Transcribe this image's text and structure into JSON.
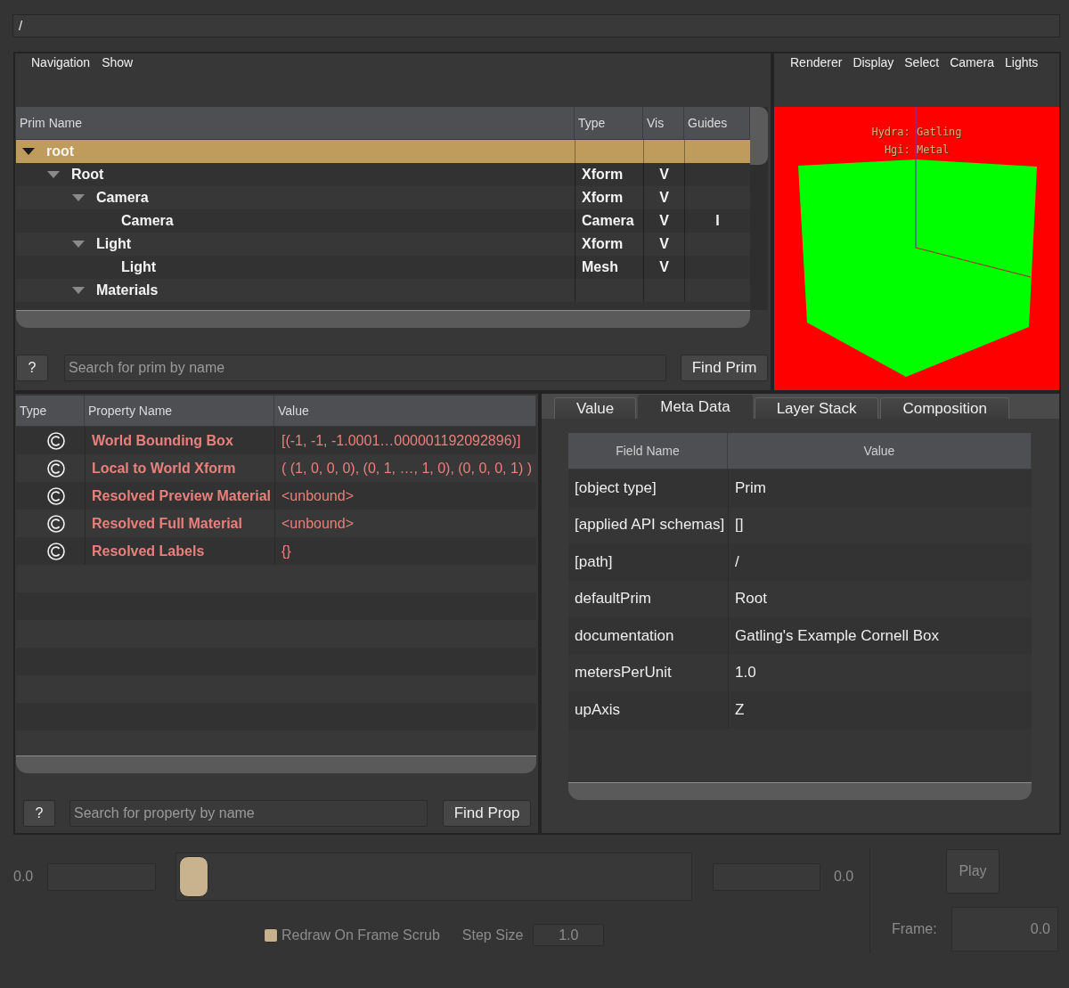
{
  "path_bar": {
    "value": "/"
  },
  "prim_browser": {
    "menus": [
      "Navigation",
      "Show"
    ],
    "columns": [
      "Prim Name",
      "Type",
      "Vis",
      "Guides"
    ],
    "tree": [
      {
        "name": "root",
        "expanded": true,
        "selected": true,
        "children": [
          {
            "name": "Root",
            "type": "Xform",
            "vis": "V",
            "expanded": true,
            "selected": false,
            "children": [
              {
                "name": "Camera",
                "type": "Xform",
                "vis": "V",
                "expanded": true,
                "selected": false,
                "children": [
                  {
                    "name": "Camera",
                    "type": "Camera",
                    "vis": "V",
                    "guides": "I",
                    "selected": false
                  }
                ]
              },
              {
                "name": "Light",
                "type": "Xform",
                "vis": "V",
                "expanded": true,
                "selected": false,
                "children": [
                  {
                    "name": "Light",
                    "type": "Mesh",
                    "vis": "V",
                    "selected": false
                  }
                ]
              },
              {
                "name": "Materials",
                "expanded": true,
                "selected": false
              }
            ]
          }
        ]
      }
    ],
    "help_button": "?",
    "search": {
      "placeholder": "Search for prim by name"
    },
    "find_button": "Find Prim"
  },
  "viewport": {
    "menus": [
      "Renderer",
      "Display",
      "Select",
      "Camera",
      "Lights"
    ],
    "hud": [
      "Hydra: Gatling",
      "Hgi: Metal"
    ]
  },
  "properties": {
    "columns": [
      "Type",
      "Property Name",
      "Value"
    ],
    "rows": [
      {
        "name": "World Bounding Box",
        "value": "[(-1, -1, -1.0001…000001192092896)]"
      },
      {
        "name": "Local to World Xform",
        "value": "( (1, 0, 0, 0), (0, 1, …, 1, 0), (0, 0, 0, 1) )"
      },
      {
        "name": "Resolved Preview Material",
        "value": "<unbound>"
      },
      {
        "name": "Resolved Full Material",
        "value": "<unbound>"
      },
      {
        "name": "Resolved Labels",
        "value": "{}"
      }
    ],
    "help_button": "?",
    "search": {
      "placeholder": "Search for property by name"
    },
    "find_button": "Find Prop"
  },
  "inspector": {
    "tabs": [
      {
        "label": "Value",
        "selected": false
      },
      {
        "label": "Meta Data",
        "selected": true
      },
      {
        "label": "Layer Stack",
        "selected": false
      },
      {
        "label": "Composition",
        "selected": false
      }
    ],
    "columns": [
      "Field Name",
      "Value"
    ],
    "rows": [
      {
        "field": "[object type]",
        "value": "Prim"
      },
      {
        "field": "[applied API schemas]",
        "value": "[]"
      },
      {
        "field": "[path]",
        "value": "/"
      },
      {
        "field": "defaultPrim",
        "value": "Root"
      },
      {
        "field": "documentation",
        "value": "Gatling's Example Cornell Box"
      },
      {
        "field": "metersPerUnit",
        "value": "1.0"
      },
      {
        "field": "upAxis",
        "value": "Z"
      }
    ]
  },
  "timeline": {
    "disabled": true,
    "start_label": "0.0",
    "end_label": "0.0",
    "slider": {
      "level": 0
    },
    "redraw_on_scrub": {
      "label": "Redraw On Frame Scrub",
      "checked": true
    },
    "step_size": {
      "label": "Step Size",
      "value": "1.0"
    },
    "play_button": "Play",
    "frame": {
      "label": "Frame:",
      "value": "0.0"
    }
  }
}
